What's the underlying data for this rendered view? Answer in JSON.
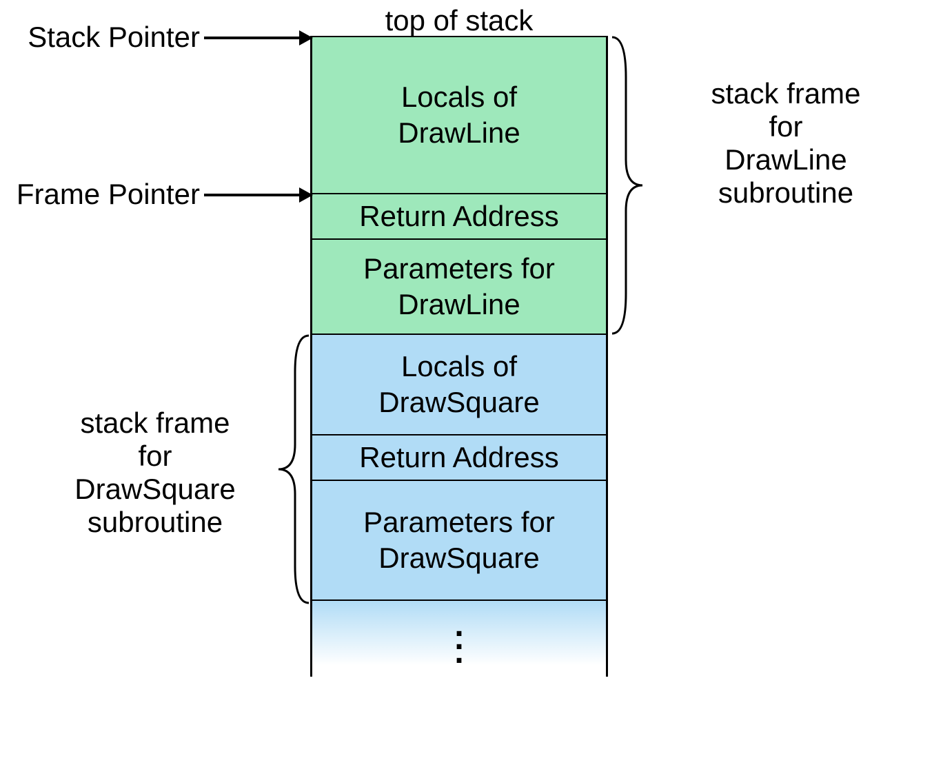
{
  "labels": {
    "top": "top of stack",
    "stackPointer": "Stack Pointer",
    "framePointer": "Frame Pointer"
  },
  "frames": {
    "drawLine": {
      "locals": "Locals of\nDrawLine",
      "return": "Return Address",
      "params": "Parameters for\nDrawLine",
      "annotation": "stack frame\nfor\nDrawLine\nsubroutine"
    },
    "drawSquare": {
      "locals": "Locals of\nDrawSquare",
      "return": "Return Address",
      "params": "Parameters for\nDrawSquare",
      "annotation": "stack frame\nfor\nDrawSquare\nsubroutine"
    }
  },
  "colors": {
    "frameA": "#9ee8bb",
    "frameB": "#b1dcf6"
  }
}
